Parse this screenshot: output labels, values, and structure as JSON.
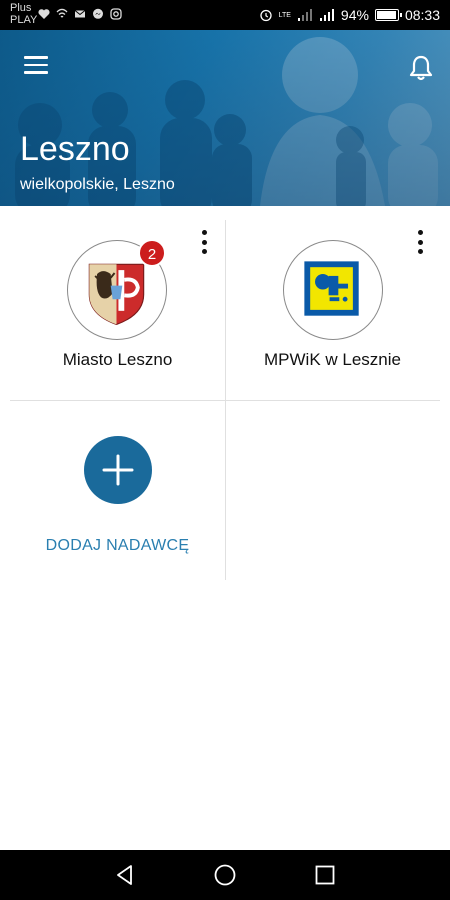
{
  "status_bar": {
    "carrier_line1": "Plus",
    "carrier_line2": "PLAY",
    "network": "LTE",
    "battery_percent": "94%",
    "battery_level": 0.94,
    "time": "08:33"
  },
  "header": {
    "title": "Leszno",
    "subtitle": "wielkopolskie, Leszno"
  },
  "senders": [
    {
      "name": "Miasto Leszno",
      "badge": "2"
    },
    {
      "name": "MPWiK w Lesznie"
    }
  ],
  "add_sender": {
    "label": "DODAJ NADAWCĘ"
  },
  "colors": {
    "accent": "#1a6a9b",
    "link": "#2a7fb0",
    "badge": "#cc1d1d",
    "mpwik_blue": "#0a5aa8",
    "mpwik_yellow": "#f2e600"
  }
}
